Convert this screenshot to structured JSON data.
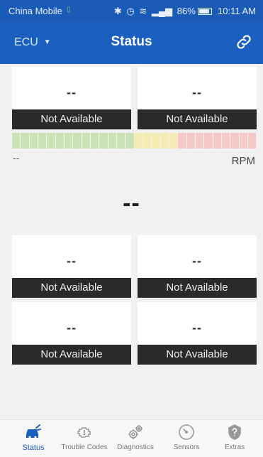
{
  "status_bar": {
    "carrier": "China Mobile",
    "battery": "86%",
    "time": "10:11 AM"
  },
  "app_bar": {
    "ecu_label": "ECU",
    "title": "Status"
  },
  "top_cards": [
    {
      "value": "--",
      "label": "Not Available"
    },
    {
      "value": "--",
      "label": "Not Available"
    }
  ],
  "rpm": {
    "left_value": "--",
    "unit": "RPM",
    "big_value": "--",
    "segment_colors": [
      "#c9e3b5",
      "#f3ecb0",
      "#f6c9c9"
    ],
    "segments": {
      "green": 14,
      "yellow": 5,
      "red": 9
    }
  },
  "bottom_cards": [
    {
      "value": "--",
      "label": "Not Available"
    },
    {
      "value": "--",
      "label": "Not Available"
    },
    {
      "value": "--",
      "label": "Not Available"
    },
    {
      "value": "--",
      "label": "Not Available"
    }
  ],
  "nav": {
    "accent": "#1b5fc1",
    "items": [
      {
        "label": "Status",
        "icon": "car-status-icon",
        "active": true
      },
      {
        "label": "Trouble Codes",
        "icon": "engine-icon",
        "active": false
      },
      {
        "label": "Diagnostics",
        "icon": "gears-icon",
        "active": false
      },
      {
        "label": "Sensors",
        "icon": "gauge-icon",
        "active": false
      },
      {
        "label": "Extras",
        "icon": "extras-icon",
        "active": false
      }
    ]
  }
}
